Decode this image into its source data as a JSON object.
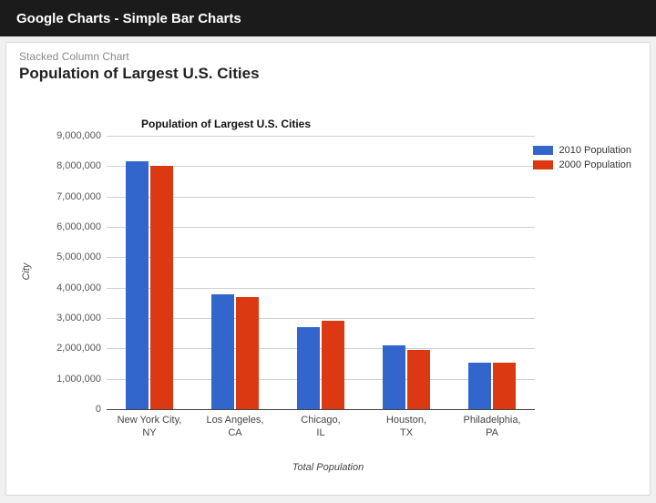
{
  "header": {
    "title": "Google Charts - Simple Bar Charts"
  },
  "card": {
    "subtitle": "Stacked Column Chart",
    "title": "Population of Largest U.S. Cities"
  },
  "chart_data": {
    "type": "bar",
    "title": "Population of Largest U.S. Cities",
    "xlabel": "Total Population",
    "ylabel": "City",
    "ylim": [
      0,
      9000000
    ],
    "y_ticks": [
      "0",
      "1,000,000",
      "2,000,000",
      "3,000,000",
      "4,000,000",
      "5,000,000",
      "6,000,000",
      "7,000,000",
      "8,000,000",
      "9,000,000"
    ],
    "categories": [
      "New York City, NY",
      "Los Angeles, CA",
      "Chicago, IL",
      "Houston, TX",
      "Philadelphia, PA"
    ],
    "series": [
      {
        "name": "2010 Population",
        "color": "#3366cc",
        "values": [
          8175133,
          3792621,
          2695598,
          2099451,
          1526006
        ]
      },
      {
        "name": "2000 Population",
        "color": "#dc3912",
        "values": [
          8008278,
          3694820,
          2896016,
          1953631,
          1517550
        ]
      }
    ]
  }
}
